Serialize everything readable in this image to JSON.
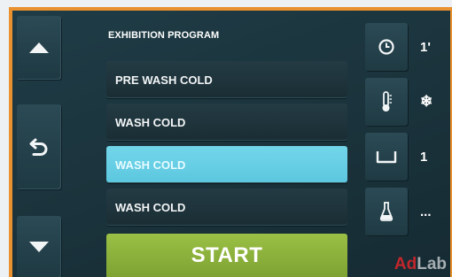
{
  "header": {
    "title": "EXHIBITION PROGRAM"
  },
  "programs": [
    {
      "label": "PRE WASH COLD",
      "selected": false
    },
    {
      "label": "WASH COLD",
      "selected": false
    },
    {
      "label": "WASH COLD",
      "selected": true
    },
    {
      "label": "WASH COLD",
      "selected": false
    }
  ],
  "start": {
    "label": "START"
  },
  "nav": {
    "up_icon": "triangle-up-icon",
    "back_icon": "back-arrow-icon",
    "down_icon": "triangle-down-icon"
  },
  "settings": {
    "time": {
      "icon": "clock-icon",
      "value": "1'"
    },
    "temperature": {
      "icon": "thermometer-icon",
      "value": "❄"
    },
    "level": {
      "icon": "tub-icon",
      "value": "1"
    },
    "detergent": {
      "icon": "flask-icon",
      "value": "..."
    }
  },
  "watermark": {
    "part1": "Ad",
    "part2": "Lab"
  },
  "colors": {
    "frame": "#e9912f",
    "screen": "#1b343d",
    "selected": "#66cfe4",
    "start": "#8db23c"
  }
}
